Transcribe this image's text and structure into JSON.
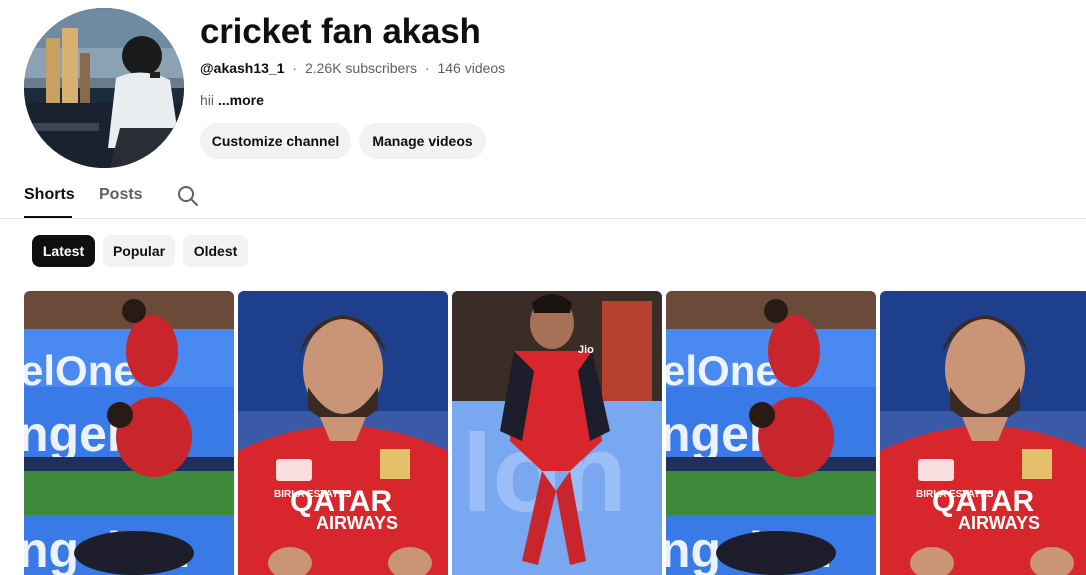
{
  "channel": {
    "name": "cricket fan akash",
    "handle": "@akash13_1",
    "subscribers": "2.26K subscribers",
    "videos": "146 videos",
    "meta_separator": "·",
    "description": "hii",
    "more_label": "...more"
  },
  "actions": {
    "customize_label": "Customize channel",
    "manage_label": "Manage videos"
  },
  "tabs": [
    {
      "label": "Shorts",
      "active": true
    },
    {
      "label": "Posts",
      "active": false
    }
  ],
  "chips": [
    {
      "label": "Latest",
      "selected": true
    },
    {
      "label": "Popular",
      "selected": false
    },
    {
      "label": "Oldest",
      "selected": false
    }
  ],
  "shorts": [
    {
      "thumbnail": "kneeling celebration collage",
      "banner_text": [
        "elOne",
        "ngelOn",
        "ngelOn"
      ]
    },
    {
      "thumbnail": "smiling player portrait",
      "shirt_text": [
        "QATAR",
        "AIRWAYS"
      ],
      "badge_text": "BIRLA ESTATES"
    },
    {
      "thumbnail": "player celebrating hands to face",
      "shirt_text": "Jio"
    },
    {
      "thumbnail": "kneeling celebration collage",
      "banner_text": [
        "elOne",
        "ngelOn",
        "ngelOn"
      ]
    },
    {
      "thumbnail": "smiling player portrait",
      "shirt_text": [
        "QATAR",
        "AIRWAYS"
      ],
      "badge_text": "BIRLA ESTATES"
    }
  ],
  "colors": {
    "text_primary": "#0f0f0f",
    "text_secondary": "#606060",
    "chip_bg": "#f2f2f2",
    "chip_selected_bg": "#0f0f0f",
    "jersey_red": "#d7262c",
    "banner_blue": "#2e6fd8"
  },
  "icons": {
    "search": "search-icon"
  }
}
